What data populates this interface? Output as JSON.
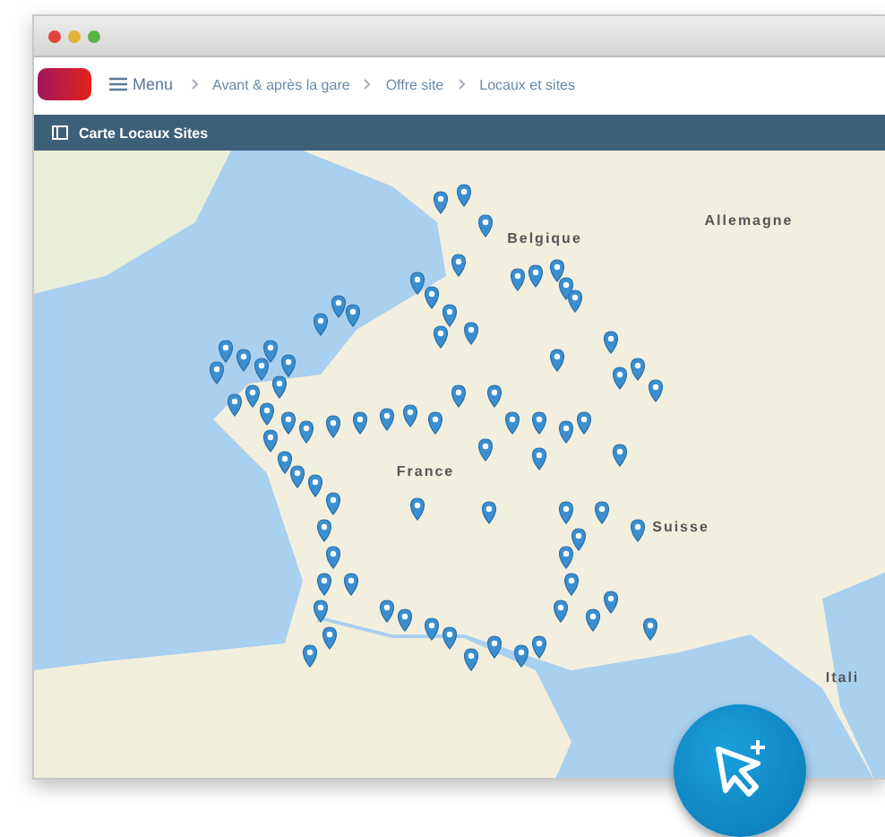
{
  "nav": {
    "menu": "Menu",
    "breadcrumbs": [
      "Avant & après la gare",
      "Offre site",
      "Locaux et sites"
    ]
  },
  "panel": {
    "title": "Carte Locaux Sites"
  },
  "map_labels": [
    {
      "text": "Allemagne",
      "kind": "country"
    },
    {
      "text": "Belgique",
      "kind": "country"
    },
    {
      "text": "France",
      "kind": "country"
    },
    {
      "text": "Suisse",
      "kind": "country"
    },
    {
      "text": "Itali",
      "kind": "country"
    }
  ]
}
